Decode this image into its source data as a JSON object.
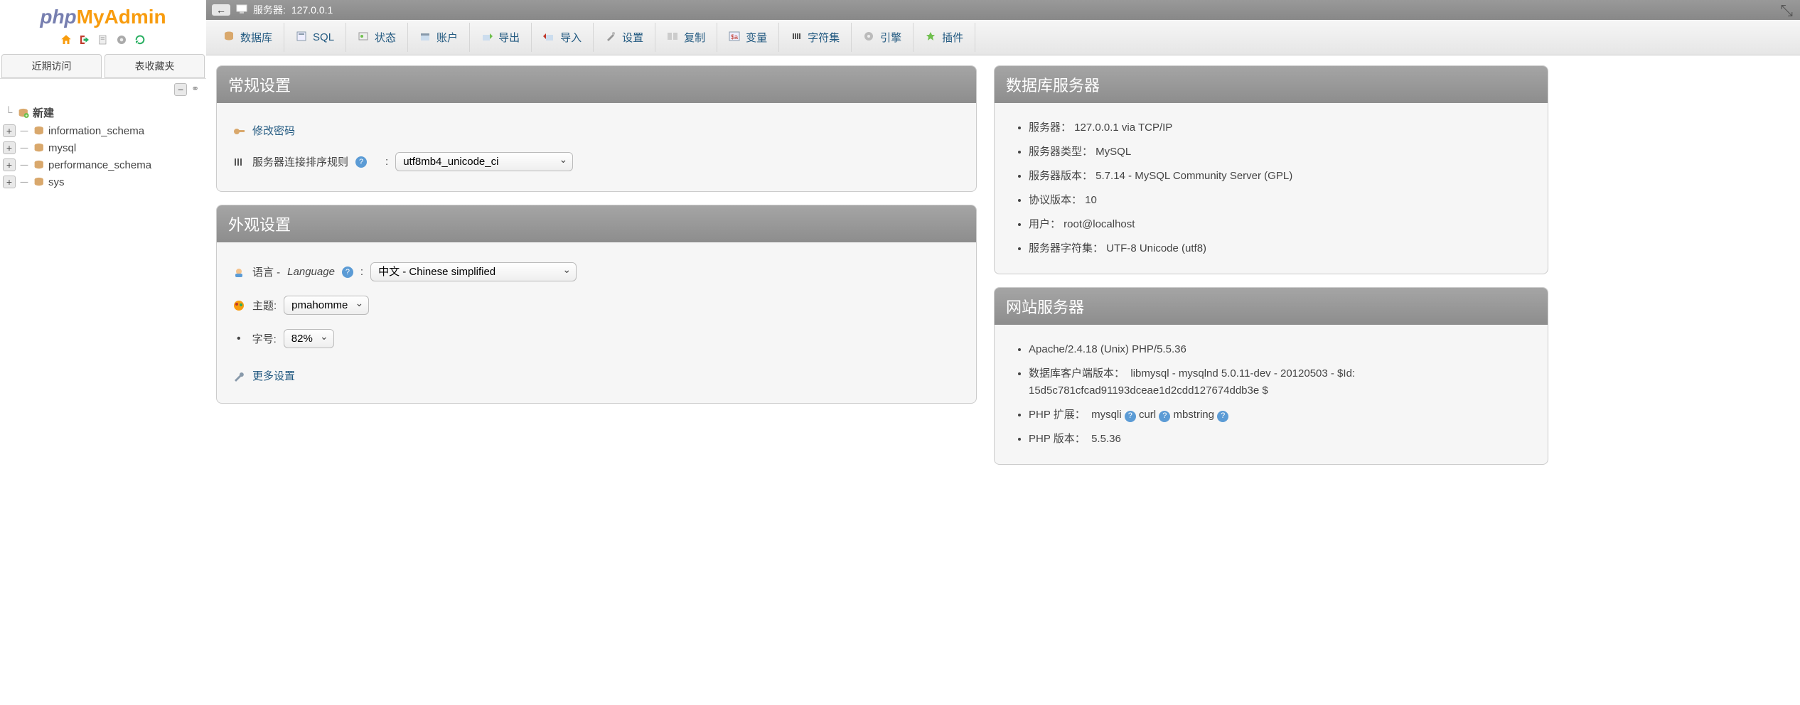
{
  "topbar": {
    "server_label": "服务器:",
    "server_value": "127.0.0.1"
  },
  "sidebar": {
    "tabs": {
      "recent": "近期访问",
      "favorites": "表收藏夹"
    },
    "new_label": "新建",
    "dbs": [
      "information_schema",
      "mysql",
      "performance_schema",
      "sys"
    ]
  },
  "menu": {
    "databases": "数据库",
    "sql": "SQL",
    "status": "状态",
    "accounts": "账户",
    "export": "导出",
    "import": "导入",
    "settings": "设置",
    "replication": "复制",
    "variables": "变量",
    "charsets": "字符集",
    "engines": "引擎",
    "plugins": "插件"
  },
  "general": {
    "title": "常规设置",
    "change_password": "修改密码",
    "collation_label": "服务器连接排序规则",
    "collation_value": "utf8mb4_unicode_ci"
  },
  "appearance": {
    "title": "外观设置",
    "language_label": "语言 -",
    "language_word": "Language",
    "language_value": "中文 - Chinese simplified",
    "theme_label": "主题:",
    "theme_value": "pmahomme",
    "fontsize_label": "字号:",
    "fontsize_value": "82%",
    "more_settings": "更多设置"
  },
  "dbserver": {
    "title": "数据库服务器",
    "items": [
      "服务器：  127.0.0.1 via TCP/IP",
      "服务器类型：  MySQL",
      "服务器版本：  5.7.14 - MySQL Community Server (GPL)",
      "协议版本：  10",
      "用户：  root@localhost",
      "服务器字符集：  UTF-8 Unicode (utf8)"
    ]
  },
  "webserver": {
    "title": "网站服务器",
    "apache": "Apache/2.4.18 (Unix) PHP/5.5.36",
    "client_label": "数据库客户端版本：",
    "client_value": "libmysql - mysqlnd 5.0.11-dev - 20120503 - $Id: 15d5c781cfcad91193dceae1d2cdd127674ddb3e $",
    "ext_label": "PHP 扩展：",
    "ext_items": [
      "mysqli",
      "curl",
      "mbstring"
    ],
    "phpver_label": "PHP 版本：",
    "phpver_value": "5.5.36"
  }
}
